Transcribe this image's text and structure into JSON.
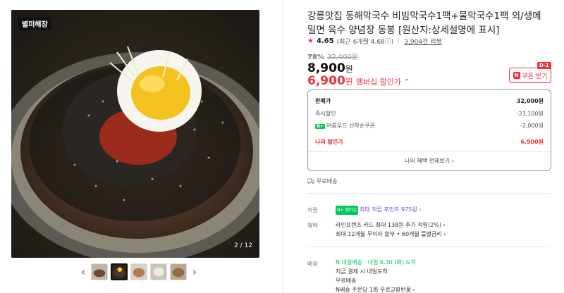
{
  "gallery": {
    "badge": "별미해장",
    "counter": "2 / 12",
    "prev_arrow": "‹",
    "next_arrow": "›"
  },
  "product": {
    "title": "강릉맛집 동해막국수 비빔막국수1팩+물막국수1팩 외/생메밀면 육수 양념장 동봉 [원산지:상세설명에 표시]",
    "rating": "4.65",
    "rating_detail": "(최근 6개월 4.68ⓘ)",
    "reviews": "3,904건 리뷰",
    "discount_pct": "78%",
    "original_price": "32,000원",
    "price": "8,900",
    "price_unit": "원",
    "member_price": "6,900",
    "member_unit": "원",
    "member_label": "멤버십 할인가 ⌃"
  },
  "coupon": {
    "dday": "D-1",
    "icon": "N",
    "label": "쿠폰 받기"
  },
  "breakdown": {
    "sale_label": "판매가",
    "sale_value": "32,000원",
    "instant_label": "즉시할인",
    "instant_value": "-23,100원",
    "summer_badge": "N+",
    "summer_label": "여름푸드 선착순쿠폰",
    "summer_value": "-2,000원",
    "my_label": "나의 할인가",
    "my_value": "6,900원",
    "all_benefits": "나의 혜택 전체보기 ›"
  },
  "shipping_free": "무료배송",
  "accumulate": {
    "label": "적립",
    "badge": "N+ 멤버십",
    "text": "최대 적립 포인트 975원 ›"
  },
  "benefit": {
    "label": "혜택",
    "line1": "라인프렌즈 카드 최대 138원 추가 적립(2%) ›",
    "line2": "최대 12개월 무이자 할부 • 60개월 틀별금리 ›"
  },
  "delivery": {
    "label": "배송",
    "badge": "N 내일배송",
    "line1": "· 내일 6.30 (화) 도착",
    "line2": "지금 결제 시 내일도착",
    "line3": "무료배송",
    "line4": "N배송 주문당 1회 무료교환반품 ›"
  },
  "colors": {
    "accent_red": "#f0333d",
    "naver_green": "#03c75a",
    "purple": "#7b3ff2"
  }
}
